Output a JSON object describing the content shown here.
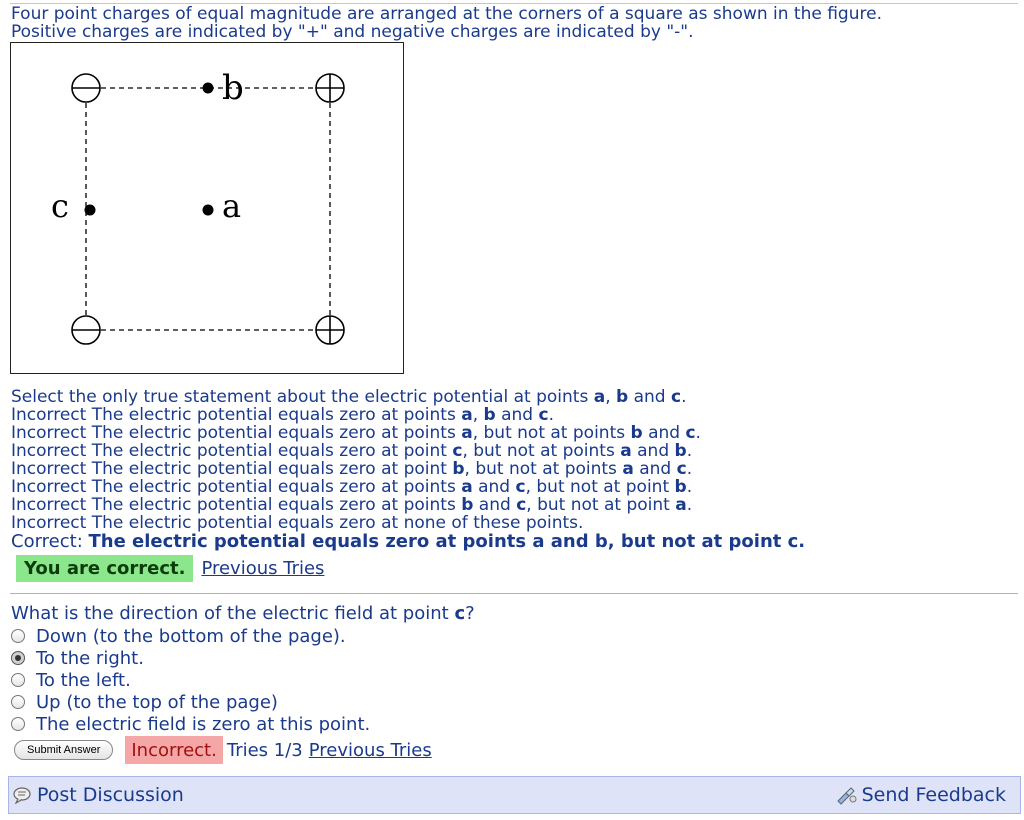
{
  "intro": {
    "line1": "Four point charges of equal magnitude are arranged at the corners of a square as shown in the figure.",
    "line2": "Positive charges are indicated by \"+\" and negative charges are indicated by \"-\"."
  },
  "figure": {
    "labels": {
      "a": "a",
      "b": "b",
      "c": "c"
    }
  },
  "question1": {
    "prompt": [
      "Select the only true statement about the electric potential at points ",
      "a",
      ", ",
      "b",
      " and ",
      "c",
      "."
    ],
    "options": [
      [
        "Incorrect The electric potential equals zero at points ",
        "a",
        ", ",
        "b",
        " and ",
        "c",
        "."
      ],
      [
        "Incorrect The electric potential equals zero at points ",
        "a",
        ", but not at points ",
        "b",
        " and ",
        "c",
        "."
      ],
      [
        "Incorrect The electric potential equals zero at point ",
        "c",
        ", but not at points ",
        "a",
        " and ",
        "b",
        "."
      ],
      [
        "Incorrect The electric potential equals zero at point ",
        "b",
        ", but not at points ",
        "a",
        " and ",
        "c",
        "."
      ],
      [
        "Incorrect The electric potential equals zero at points ",
        "a",
        " and ",
        "c",
        ", but not at point ",
        "b",
        "."
      ],
      [
        "Incorrect The electric potential equals zero at points ",
        "b",
        " and ",
        "c",
        ", but not at point ",
        "a",
        "."
      ],
      [
        "Incorrect The electric potential equals zero at none of these points."
      ]
    ],
    "correct_prefix": "Correct: ",
    "correct_text": "The electric potential equals zero at points a and b, but not at point c.",
    "status": "You are correct.",
    "previous_tries": "Previous Tries"
  },
  "question2": {
    "prompt_a": "What is the direction of the electric field at point ",
    "prompt_b": "c",
    "prompt_c": "?",
    "options": [
      "Down (to the bottom of the page).",
      "To the right.",
      "To the left.",
      "Up (to the top of the page)",
      "The electric field is zero at this point."
    ],
    "selected_index": 1,
    "submit_label": "Submit Answer",
    "status": "Incorrect.",
    "tries": "Tries 1/3",
    "previous_tries": "Previous Tries"
  },
  "footer": {
    "post_discussion": "Post Discussion",
    "send_feedback": "Send Feedback"
  },
  "colors": {
    "text": "#1a3a8c",
    "correct_badge": "#8ce68c",
    "incorrect_badge": "#f5a6a6",
    "footer_bg": "#dfe3f7"
  },
  "icons": [
    "discussion-icon",
    "feedback-icon"
  ]
}
